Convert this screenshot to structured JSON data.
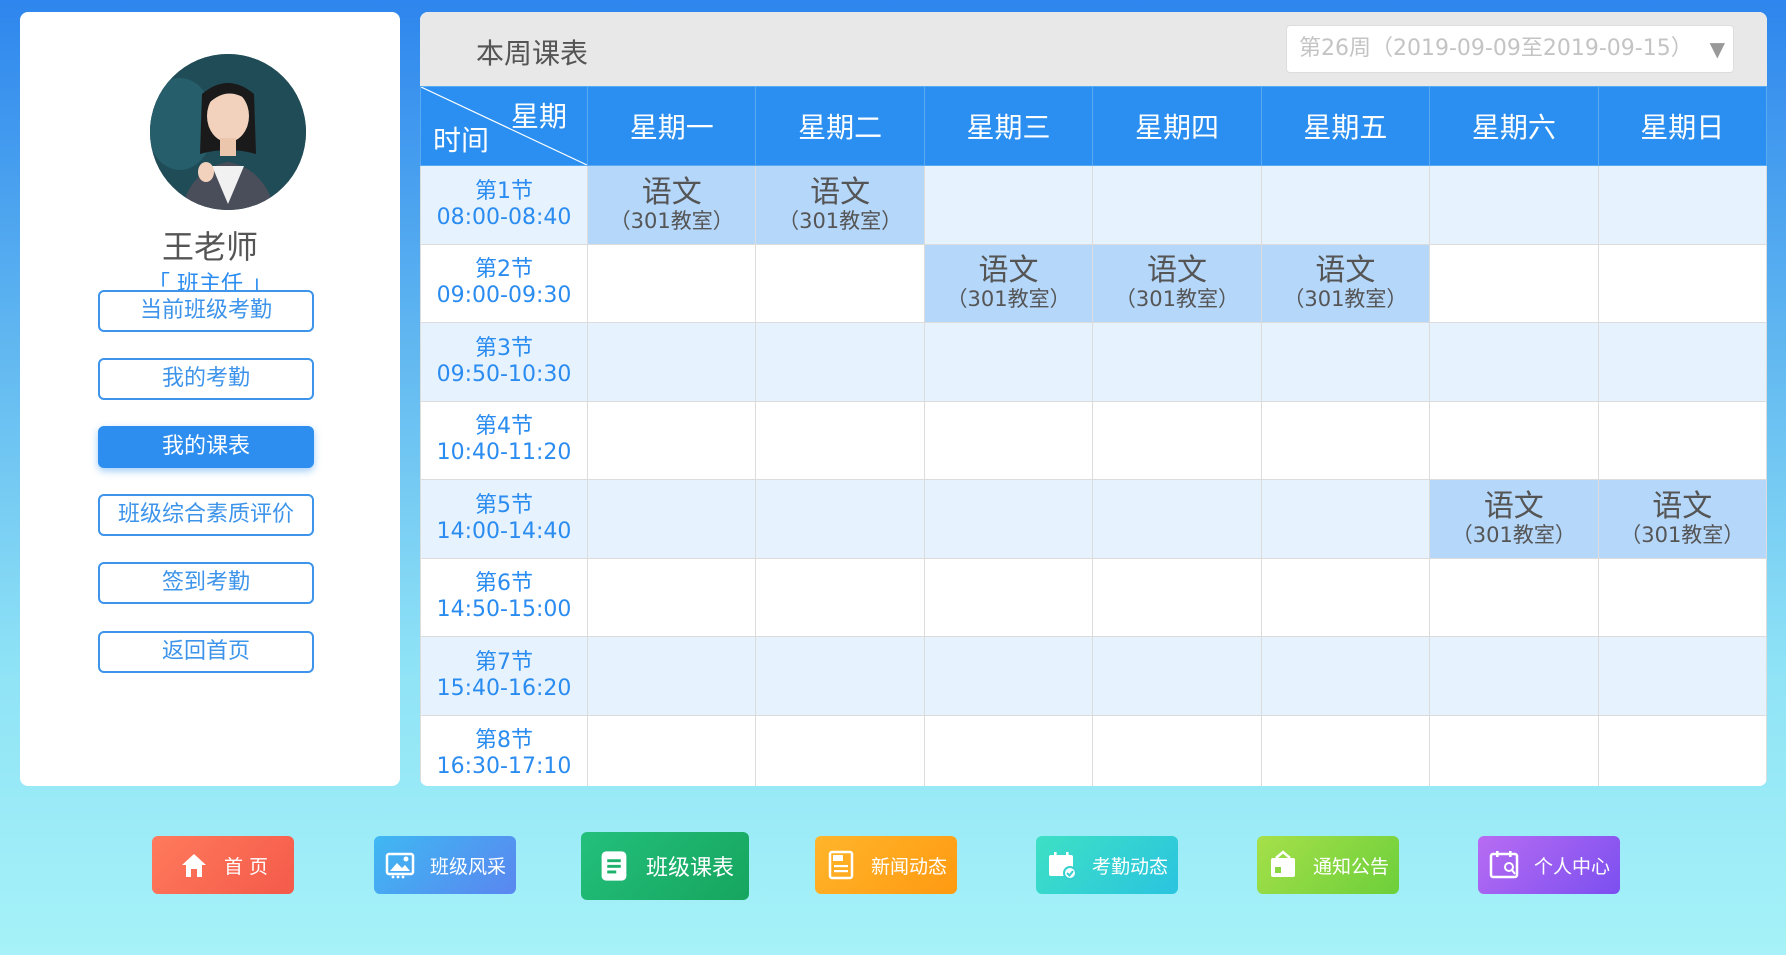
{
  "profile": {
    "name": "王老师",
    "role": "「 班主任 」",
    "nav": [
      {
        "label": "当前班级考勤",
        "active": false
      },
      {
        "label": "我的考勤",
        "active": false
      },
      {
        "label": "我的课表",
        "active": true
      },
      {
        "label": "班级综合素质评价",
        "active": false
      },
      {
        "label": "签到考勤",
        "active": false
      },
      {
        "label": "返回首页",
        "active": false
      }
    ]
  },
  "schedule": {
    "title": "本周课表",
    "week_selector": "第26周（2019-09-09至2019-09-15）",
    "corner_top": "星期",
    "corner_bottom": "时间",
    "days": [
      "星期一",
      "星期二",
      "星期三",
      "星期四",
      "星期五",
      "星期六",
      "星期日"
    ],
    "periods": [
      {
        "name": "第1节",
        "time": "08:00-08:40"
      },
      {
        "name": "第2节",
        "time": "09:00-09:30"
      },
      {
        "name": "第3节",
        "time": "09:50-10:30"
      },
      {
        "name": "第4节",
        "time": "10:40-11:20"
      },
      {
        "name": "第5节",
        "time": "14:00-14:40"
      },
      {
        "name": "第6节",
        "time": "14:50-15:00"
      },
      {
        "name": "第7节",
        "time": "15:40-16:20"
      },
      {
        "name": "第8节",
        "time": "16:30-17:10"
      }
    ],
    "lessons": [
      {
        "period": 1,
        "day": 1,
        "subject": "语文",
        "room": "（301教室）"
      },
      {
        "period": 1,
        "day": 2,
        "subject": "语文",
        "room": "（301教室）"
      },
      {
        "period": 2,
        "day": 3,
        "subject": "语文",
        "room": "（301教室）"
      },
      {
        "period": 2,
        "day": 4,
        "subject": "语文",
        "room": "（301教室）"
      },
      {
        "period": 2,
        "day": 5,
        "subject": "语文",
        "room": "（301教室）"
      },
      {
        "period": 5,
        "day": 6,
        "subject": "语文",
        "room": "（301教室）"
      },
      {
        "period": 5,
        "day": 7,
        "subject": "语文",
        "room": "（301教室）"
      }
    ]
  },
  "dock": [
    {
      "label": "首 页",
      "icon": "home-icon",
      "color_from": "#ff7a5c",
      "color_to": "#f45a4a",
      "active": false
    },
    {
      "label": "班级风采",
      "icon": "gallery-icon",
      "color_from": "#3fb8f2",
      "color_to": "#5a86f0",
      "active": false
    },
    {
      "label": "班级课表",
      "icon": "schedule-icon",
      "color_from": "#23c07c",
      "color_to": "#16a55e",
      "active": true
    },
    {
      "label": "新闻动态",
      "icon": "news-icon",
      "color_from": "#ffb52a",
      "color_to": "#ff9a12",
      "active": false
    },
    {
      "label": "考勤动态",
      "icon": "attendance-icon",
      "color_from": "#3ee0c4",
      "color_to": "#2ac4e0",
      "active": false
    },
    {
      "label": "通知公告",
      "icon": "notice-icon",
      "color_from": "#a6e04a",
      "color_to": "#6ccf3a",
      "active": false
    },
    {
      "label": "个人中心",
      "icon": "user-center-icon",
      "color_from": "#b86cf2",
      "color_to": "#7b4ff0",
      "active": false
    }
  ]
}
